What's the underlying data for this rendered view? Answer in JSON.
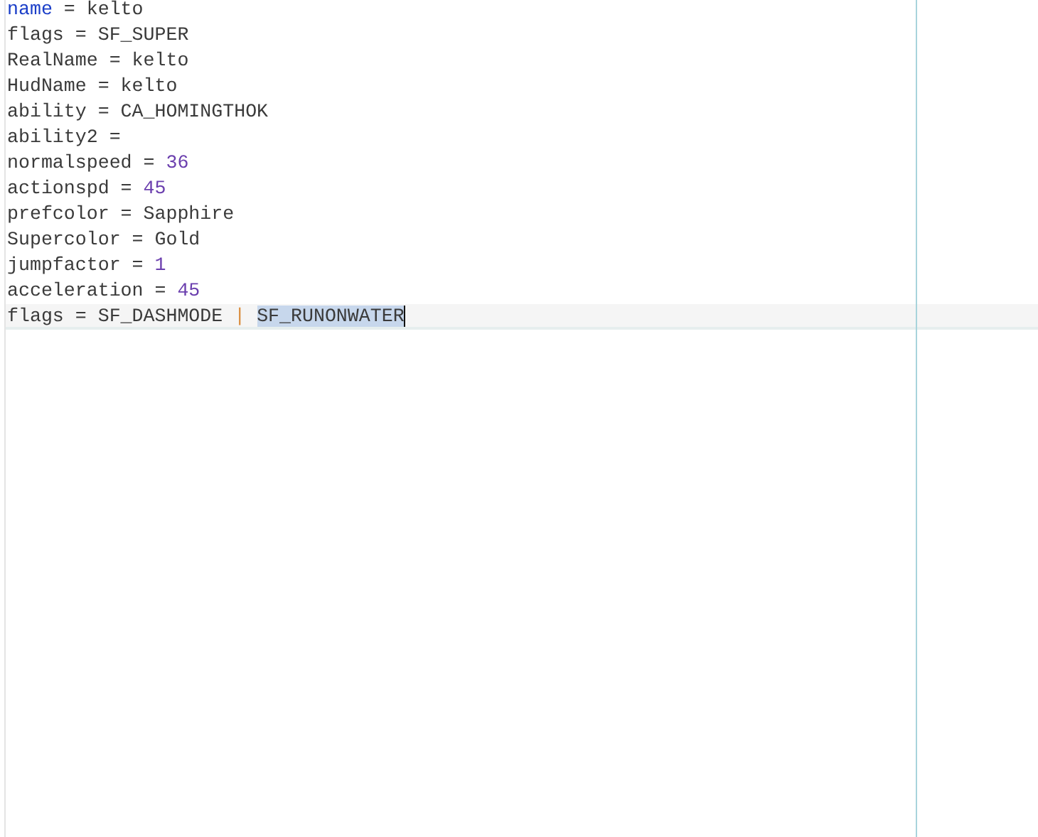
{
  "editor": {
    "lines": [
      {
        "current": false,
        "tokens": [
          {
            "text": "name",
            "kind": "keyword",
            "selected": false
          },
          {
            "text": " = kelto",
            "kind": "plain",
            "selected": false
          }
        ]
      },
      {
        "current": false,
        "tokens": [
          {
            "text": "flags = SF_SUPER",
            "kind": "plain",
            "selected": false
          }
        ]
      },
      {
        "current": false,
        "tokens": [
          {
            "text": "RealName = kelto",
            "kind": "plain",
            "selected": false
          }
        ]
      },
      {
        "current": false,
        "tokens": [
          {
            "text": "HudName = kelto",
            "kind": "plain",
            "selected": false
          }
        ]
      },
      {
        "current": false,
        "tokens": [
          {
            "text": "ability = CA_HOMINGTHOK",
            "kind": "plain",
            "selected": false
          }
        ]
      },
      {
        "current": false,
        "tokens": [
          {
            "text": "ability2 =",
            "kind": "plain",
            "selected": false
          }
        ]
      },
      {
        "current": false,
        "tokens": [
          {
            "text": "normalspeed = ",
            "kind": "plain",
            "selected": false
          },
          {
            "text": "36",
            "kind": "number",
            "selected": false
          }
        ]
      },
      {
        "current": false,
        "tokens": [
          {
            "text": "actionspd = ",
            "kind": "plain",
            "selected": false
          },
          {
            "text": "45",
            "kind": "number",
            "selected": false
          }
        ]
      },
      {
        "current": false,
        "tokens": [
          {
            "text": "prefcolor = Sapphire",
            "kind": "plain",
            "selected": false
          }
        ]
      },
      {
        "current": false,
        "tokens": [
          {
            "text": "Supercolor = Gold",
            "kind": "plain",
            "selected": false
          }
        ]
      },
      {
        "current": false,
        "tokens": [
          {
            "text": "jumpfactor = ",
            "kind": "plain",
            "selected": false
          },
          {
            "text": "1",
            "kind": "number",
            "selected": false
          }
        ]
      },
      {
        "current": false,
        "tokens": [
          {
            "text": "acceleration = ",
            "kind": "plain",
            "selected": false
          },
          {
            "text": "45",
            "kind": "number",
            "selected": false
          }
        ]
      },
      {
        "current": true,
        "tokens": [
          {
            "text": "flags = SF_DASHMODE ",
            "kind": "plain",
            "selected": false
          },
          {
            "text": "| ",
            "kind": "operator",
            "selected": false
          },
          {
            "text": "SF_RUNONWATER",
            "kind": "plain",
            "selected": true
          }
        ]
      }
    ]
  }
}
